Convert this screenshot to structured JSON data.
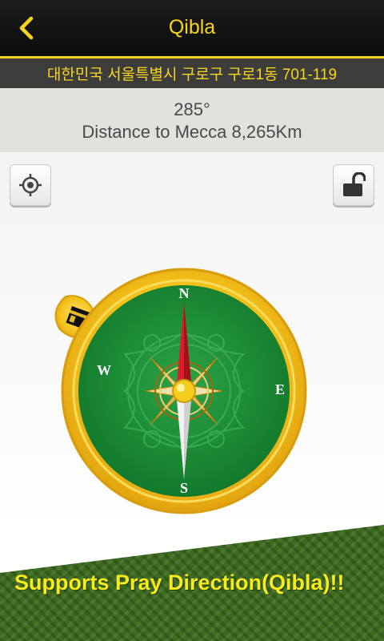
{
  "header": {
    "title": "Qibla",
    "back_icon": "chevron-left-icon",
    "accent_color": "#f7d51d"
  },
  "address": "대한민국 서울특별시 구로구 구로1동 701-119",
  "info": {
    "direction": "285°",
    "distance": "Distance to Mecca 8,265Km"
  },
  "controls": {
    "locate_icon": "crosshair-icon",
    "lock_icon": "unlock-icon"
  },
  "compass": {
    "north": "N",
    "east": "E",
    "south": "S",
    "west": "W",
    "qibla_bearing": 285,
    "kaaba_icon": "kaaba-icon"
  },
  "footer": {
    "tagline": "Supports Pray Direction(Qibla)!!"
  }
}
